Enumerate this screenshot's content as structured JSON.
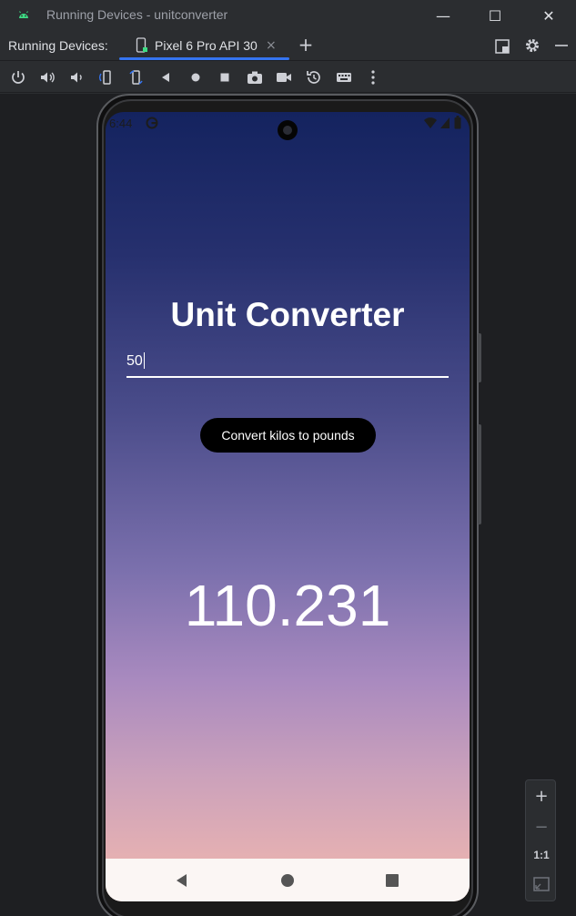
{
  "window": {
    "title": "Running Devices - unitconverter",
    "controls": {
      "minimize": "—",
      "maximize": "☐",
      "close": "✕"
    }
  },
  "tabbar": {
    "label": "Running Devices:",
    "tab": {
      "name": "Pixel 6 Pro API 30",
      "close": "×"
    },
    "add": "+"
  },
  "toolbar": {
    "icons": [
      "power-icon",
      "volume-up-icon",
      "volume-down-icon",
      "rotate-left-icon",
      "rotate-right-icon",
      "back-icon",
      "home-icon",
      "overview-icon",
      "screenshot-icon",
      "screen-record-icon",
      "snapshot-icon",
      "keyboard-icon",
      "more-icon"
    ]
  },
  "device": {
    "status_time": "6:44",
    "app": {
      "title": "Unit Converter",
      "input_value": "50",
      "button_label": "Convert kilos to pounds",
      "result": "110.231"
    }
  },
  "zoom": {
    "in": "+",
    "out": "−",
    "actual": "1:1"
  },
  "colors": {
    "accent": "#3574f0",
    "background": "#2b2d30",
    "button": "#000000"
  }
}
